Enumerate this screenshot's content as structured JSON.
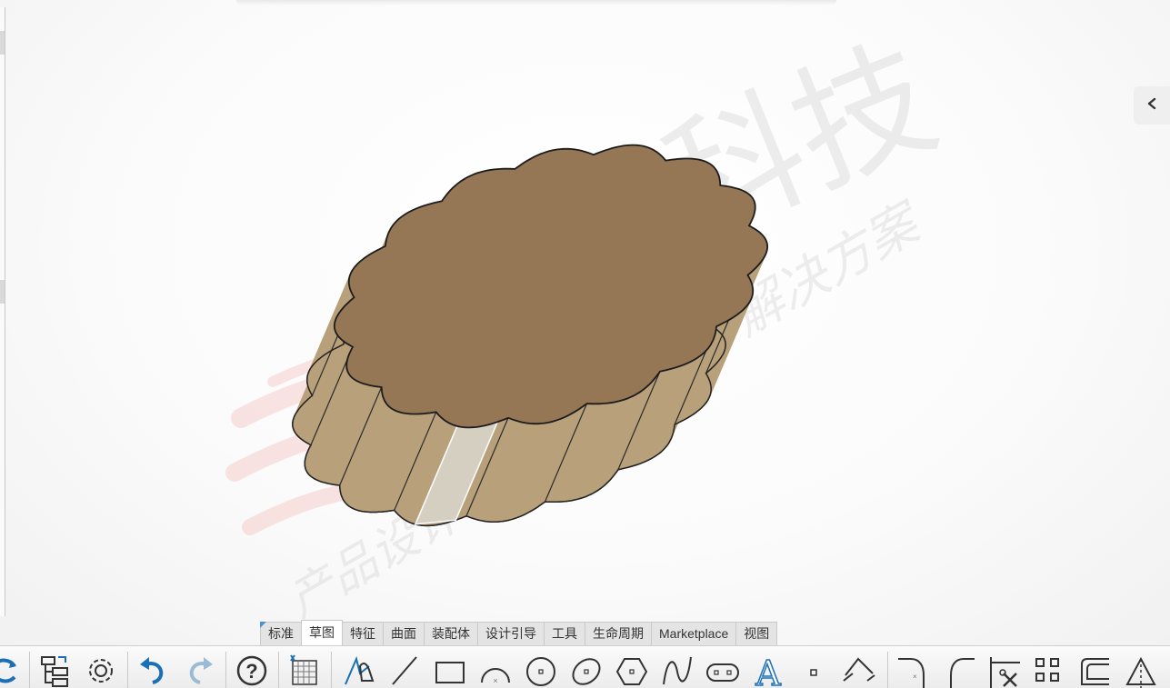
{
  "viewport": {
    "model": "scalloped-cylinder",
    "model_top_color": "#957756",
    "model_side_color": "#b8a07a",
    "highlight_face_color": "#d4cfc0",
    "watermark_text": "科技",
    "watermark_script": "解决方案",
    "watermark_script2": "产品设计"
  },
  "right_panel": {
    "icon": "chevron-left-icon"
  },
  "tabs": [
    {
      "label": "标准",
      "active": false
    },
    {
      "label": "草图",
      "active": true
    },
    {
      "label": "特征",
      "active": false
    },
    {
      "label": "曲面",
      "active": false
    },
    {
      "label": "装配体",
      "active": false
    },
    {
      "label": "设计引导",
      "active": false
    },
    {
      "label": "工具",
      "active": false
    },
    {
      "label": "生命周期",
      "active": false
    },
    {
      "label": "Marketplace",
      "active": false
    },
    {
      "label": "视图",
      "active": false
    }
  ],
  "toolbar_icons": [
    "rebuild-icon",
    "model-tree-icon",
    "settings-icon",
    "undo-icon",
    "redo-icon",
    "help-icon",
    "sketch-grid-icon",
    "smart-sketch-icon",
    "line-icon",
    "rectangle-icon",
    "arc-icon",
    "circle-icon",
    "ellipse-icon",
    "polygon-icon",
    "spline-icon",
    "slot-icon",
    "text-icon",
    "point-icon",
    "dimension-icon",
    "fillet-icon",
    "chamfer-icon",
    "trim-icon",
    "offset-icon",
    "convert-edge-icon",
    "mirror-icon"
  ],
  "colors": {
    "accent": "#1a6fb5",
    "tab_marker": "#4a90d9"
  }
}
